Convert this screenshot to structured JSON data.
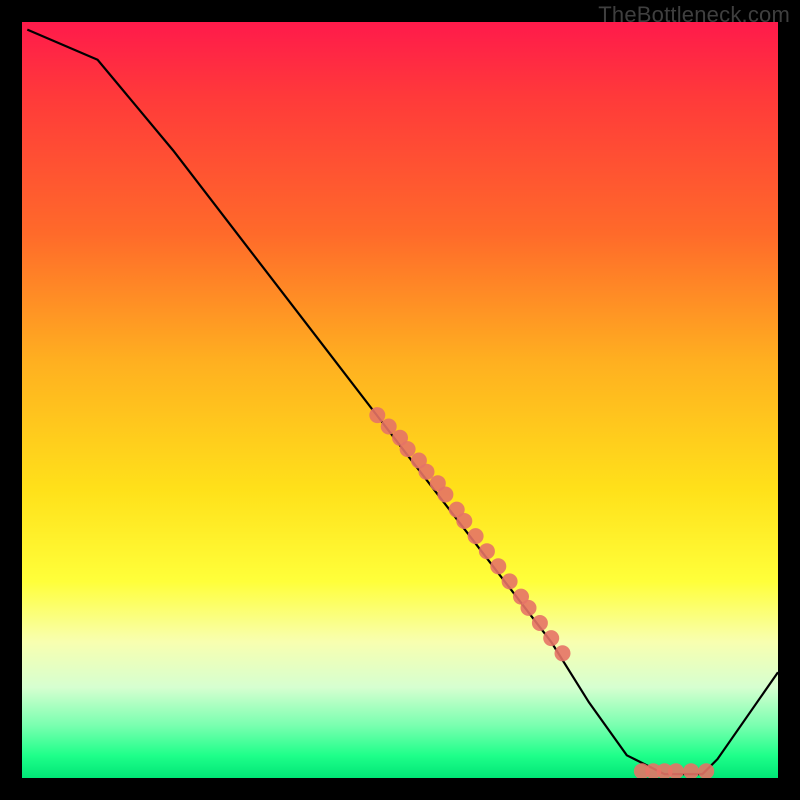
{
  "watermark": "TheBottleneck.com",
  "colors": {
    "curve_stroke": "#000000",
    "marker_fill": "#e57366",
    "marker_stroke": "#e57366"
  },
  "chart_data": {
    "type": "line",
    "title": "",
    "xlabel": "",
    "ylabel": "",
    "xlim": [
      0,
      100
    ],
    "ylim": [
      0,
      100
    ],
    "grid": false,
    "series": [
      {
        "name": "curve",
        "render": "line",
        "x": [
          0.7,
          10,
          20,
          30,
          40,
          50,
          60,
          70,
          75,
          80,
          85,
          90,
          92,
          100
        ],
        "y": [
          99,
          95,
          83,
          70,
          57,
          44,
          31,
          18,
          10,
          3,
          0.5,
          0.5,
          2.5,
          14
        ]
      },
      {
        "name": "markers-diagonal",
        "render": "scatter",
        "x": [
          47,
          48.5,
          50,
          51,
          52.5,
          53.5,
          55,
          56,
          57.5,
          58.5,
          60,
          61.5,
          63,
          64.5,
          66,
          67,
          68.5,
          70,
          71.5
        ],
        "y": [
          48,
          46.5,
          45,
          43.5,
          42,
          40.5,
          39,
          37.5,
          35.5,
          34,
          32,
          30,
          28,
          26,
          24,
          22.5,
          20.5,
          18.5,
          16.5
        ]
      },
      {
        "name": "markers-basin",
        "render": "scatter",
        "x": [
          82,
          83.5,
          85,
          86.5,
          88.5,
          90.5
        ],
        "y": [
          0.9,
          0.9,
          0.9,
          0.9,
          0.9,
          0.9
        ]
      }
    ]
  }
}
